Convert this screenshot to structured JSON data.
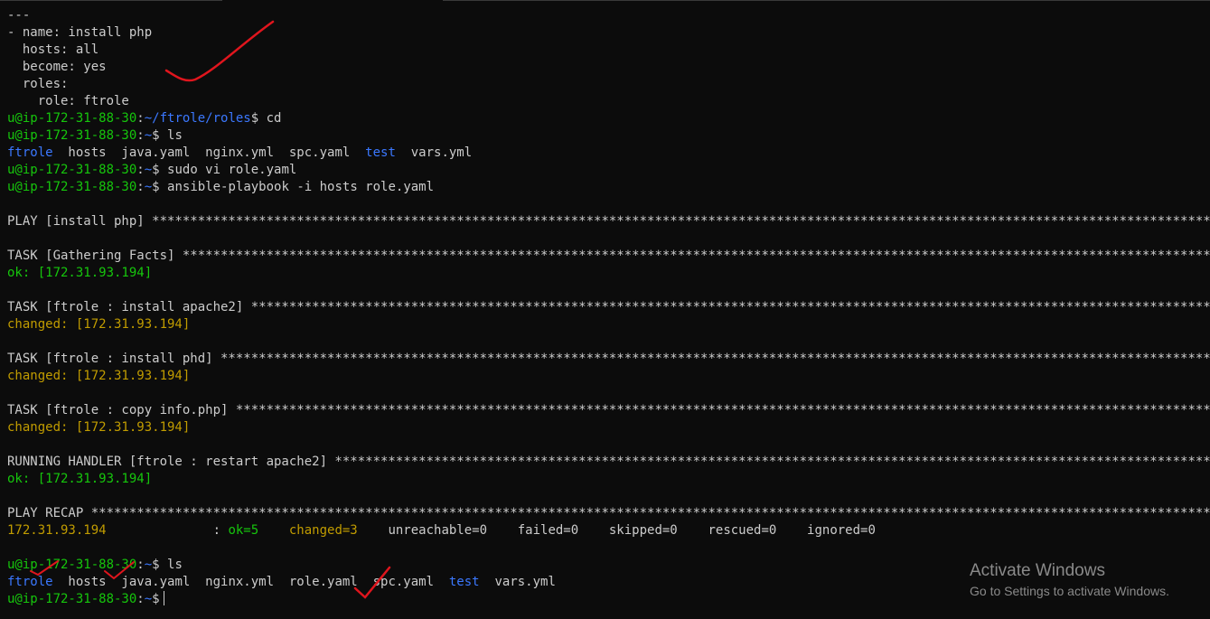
{
  "terminal": {
    "prompt_user": "u@ip-172-31-88-30",
    "prompt_sep": ":",
    "path_roles": "~/ftrole/roles",
    "path_home": "~",
    "prompt_dollar": "$",
    "yaml": {
      "doc_start": "---",
      "name_line": "- name: install php",
      "hosts_line": "  hosts: all",
      "become_line": "  become: yes",
      "roles_line": "  roles:",
      "role_line": "    role: ftrole"
    },
    "commands": {
      "cd": " cd",
      "ls": " ls",
      "vi": " sudo vi role.yaml",
      "playbook": " ansible-playbook -i hosts role.yaml"
    },
    "ls1": {
      "dir1": "ftrole",
      "files1": "  hosts  java.yaml  nginx.yml  spc.yaml  ",
      "dir2": "test",
      "files2": "  vars.yml"
    },
    "ls2": {
      "dir1": "ftrole",
      "files1": "  hosts  java.yaml  nginx.yml  role.yaml  spc.yaml  ",
      "dir2": "test",
      "files2": "  vars.yml"
    },
    "output": {
      "play": "PLAY [install php] *****************************************************************************************************************************************************",
      "task_facts": "TASK [Gathering Facts] *************************************************************************************************************************************************",
      "ok_facts": "ok: [172.31.93.194]",
      "task_apache": "TASK [ftrole : install apache2] ****************************************************************************************************************************************",
      "changed_apache": "changed: [172.31.93.194]",
      "task_phd": "TASK [ftrole : install phd] ********************************************************************************************************************************************",
      "changed_phd": "changed: [172.31.93.194]",
      "task_copy": "TASK [ftrole : copy info.php] ******************************************************************************************************************************************",
      "changed_copy": "changed: [172.31.93.194]",
      "handler": "RUNNING HANDLER [ftrole : restart apache2] *****************************************************************************************************************************",
      "ok_handler": "ok: [172.31.93.194]",
      "recap": "PLAY RECAP *************************************************************************************************************************************************************",
      "recap_host": "172.31.93.194",
      "recap_gap": "              : ",
      "recap_ok": "ok=5",
      "recap_changed": "changed=3",
      "recap_rest": "    unreachable=0    failed=0    skipped=0    rescued=0    ignored=0"
    }
  },
  "watermark": {
    "title": "Activate Windows",
    "subtitle": "Go to Settings to activate Windows."
  },
  "colors": {
    "background": "#0c0c0c",
    "text": "#cccccc",
    "prompt_green": "#16c60c",
    "path_blue": "#3b78ff",
    "changed_yellow": "#c19c00",
    "annotation_red": "#e0151d"
  }
}
